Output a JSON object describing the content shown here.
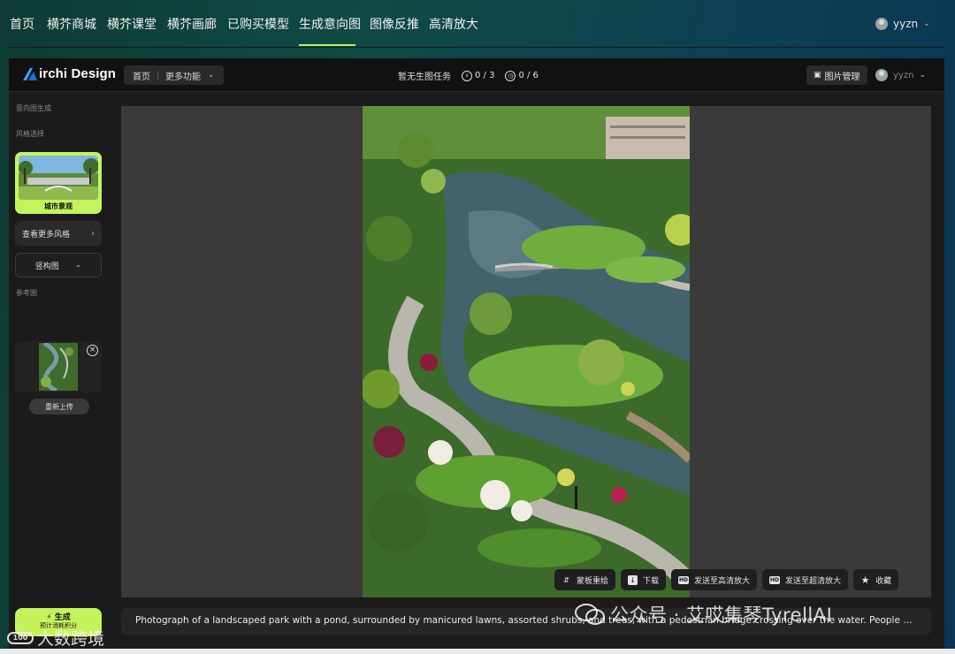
{
  "top_nav": {
    "items": [
      "首页",
      "横芥商城",
      "横芥课堂",
      "横芥画廊",
      "已购买模型",
      "生成意向图",
      "图像反推",
      "高清放大"
    ],
    "active_index": 5,
    "user": "yyzn",
    "accent": "#b8f15a"
  },
  "app_header": {
    "brand": "irchi Design",
    "nav": {
      "home": "首页",
      "more": "更多功能"
    },
    "task_status": "暂无生图任务",
    "counter_a": "0 / 3",
    "counter_b": "0 / 6",
    "image_manager": "图片管理",
    "user": "yyzn"
  },
  "sidebar": {
    "section_title": "意向图生成",
    "style_label": "风格选择",
    "selected_style": "城市景观",
    "more_styles": "查看更多风格",
    "composition": "竖构图",
    "reference_label": "参考图",
    "reupload": "重新上传",
    "generate": "生成",
    "generate_sub": "预计消耗积分"
  },
  "toolbar": {
    "mask": "蒙板重绘",
    "download": "下载",
    "send_hd": "发送至高清放大",
    "send_uhd": "发送至超清放大",
    "favorite": "收藏"
  },
  "prompt_text": "Photograph of a landscaped park with a pond, surrounded by manicured lawns, assorted shrubs, and trees, with a pedestrian bridge crossing over the water. People ar...",
  "watermarks": {
    "wechat": "公众号 · 艾哎集琴TyrellAI",
    "corner": "大数跨境",
    "corner_logo": "100"
  },
  "colors": {
    "accent": "#c5f35c",
    "panel": "#1b1b1b",
    "canvas": "#3a3a3a"
  }
}
